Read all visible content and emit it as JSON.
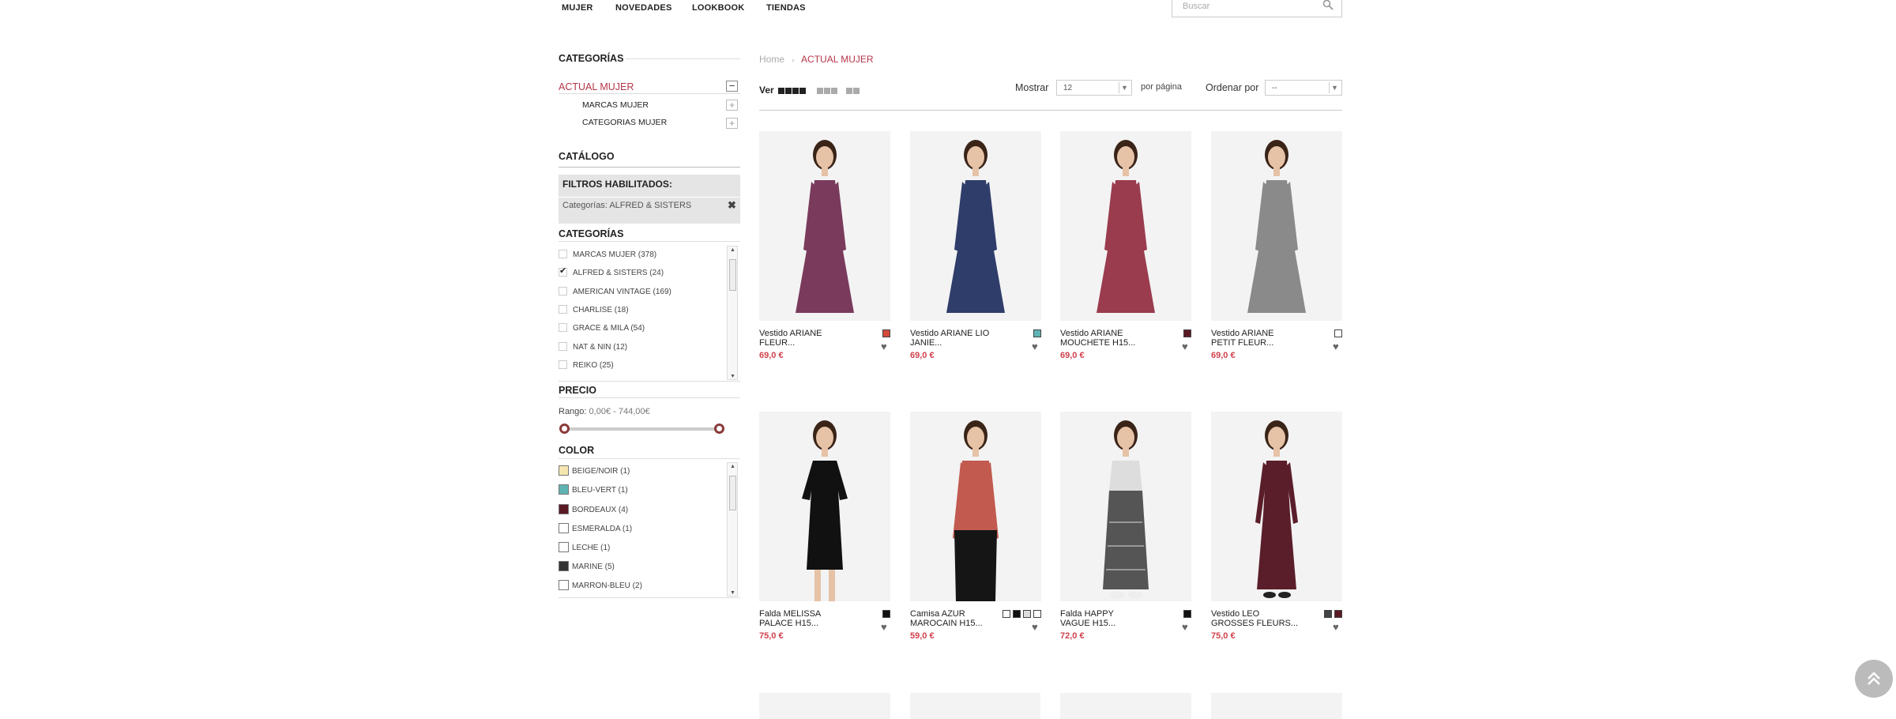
{
  "nav": {
    "items": [
      "MUJER",
      "NOVEDADES",
      "LOOKBOOK",
      "TIENDAS"
    ]
  },
  "search": {
    "placeholder": "Buscar"
  },
  "sidebar": {
    "categories_title": "CATEGORÍAS",
    "current_category": "ACTUAL MUJER",
    "subcategories": [
      "MARCAS MUJER",
      "CATEGORIAS MUJER"
    ],
    "catalog_title": "CATÁLOGO",
    "filters_title": "FILTROS HABILITADOS:",
    "active_filter": "Categorías: ALFRED & SISTERS",
    "cat_filter_title": "CATEGORÍAS",
    "cat_options": [
      {
        "label": "MARCAS MUJER (378)",
        "checked": false
      },
      {
        "label": "ALFRED & SISTERS (24)",
        "checked": true
      },
      {
        "label": "AMERICAN VINTAGE (169)",
        "checked": false
      },
      {
        "label": "CHARLISE (18)",
        "checked": false
      },
      {
        "label": "GRACE & MILA (54)",
        "checked": false
      },
      {
        "label": "NAT & NIN (12)",
        "checked": false
      },
      {
        "label": "REIKO (25)",
        "checked": false
      }
    ],
    "price_title": "PRECIO",
    "range_label": "Rango:",
    "range_value": "0,00€ - 744,00€",
    "range_min_fraction": 0,
    "range_max_fraction": 1,
    "color_title": "COLOR",
    "colors": [
      {
        "label": "BEIGE/NOIR (1)",
        "color": "#f5e6b0"
      },
      {
        "label": "BLEU-VERT (1)",
        "color": "#5fb3b3"
      },
      {
        "label": "BORDEAUX (4)",
        "color": "#5a1a24"
      },
      {
        "label": "ESMERALDA (1)",
        "color": "#ffffff"
      },
      {
        "label": "LECHE (1)",
        "color": "#ffffff"
      },
      {
        "label": "MARINE (5)",
        "color": "#333333"
      },
      {
        "label": "MARRON-BLEU (2)",
        "color": "#ffffff"
      }
    ]
  },
  "breadcrumb": {
    "home": "Home",
    "current": "ACTUAL MUJER"
  },
  "toolbar": {
    "view_label": "Ver",
    "show_label": "Mostrar",
    "show_value": "12",
    "per_page": "por página",
    "sort_label": "Ordenar por",
    "sort_value": "--"
  },
  "products": [
    {
      "name1": "Vestido ARIANE",
      "name2": "FLEUR...",
      "price": "69,0 €",
      "swatches": [
        "#d24a3c"
      ],
      "garment": "#7a3a5c",
      "style": "dress"
    },
    {
      "name1": "Vestido ARIANE LIO",
      "name2": "JANIE...",
      "price": "69,0 €",
      "swatches": [
        "#5fb3b3"
      ],
      "garment": "#2f3d6a",
      "style": "dress"
    },
    {
      "name1": "Vestido ARIANE",
      "name2": "MOUCHETE H15...",
      "price": "69,0 €",
      "swatches": [
        "#5a1a24"
      ],
      "garment": "#9a3b4e",
      "style": "dress"
    },
    {
      "name1": "Vestido ARIANE",
      "name2": "PETIT FLEUR...",
      "price": "69,0 €",
      "swatches": [
        "#ffffff"
      ],
      "garment": "#8a8a8a",
      "style": "dress"
    },
    {
      "name1": "Falda MELISSA",
      "name2": "PALACE H15...",
      "price": "75,0 €",
      "swatches": [
        "#111111"
      ],
      "garment": "#111111",
      "style": "dress2"
    },
    {
      "name1": "Camisa AZUR",
      "name2": "MAROCAIN H15...",
      "price": "59,0 €",
      "swatches": [
        "#ffffff",
        "#111111",
        "#dddddd",
        "#ffffff"
      ],
      "garment": "#c25a50",
      "style": "shirt"
    },
    {
      "name1": "Falda HAPPY",
      "name2": "VAGUE H15...",
      "price": "72,0 €",
      "swatches": [
        "#111111"
      ],
      "garment": "#555555",
      "style": "skirt"
    },
    {
      "name1": "Vestido LEO",
      "name2": "GROSSES FLEURS...",
      "price": "75,0 €",
      "swatches": [
        "#444444",
        "#5a1a24"
      ],
      "garment": "#5a1e2a",
      "style": "long"
    }
  ],
  "icons": {
    "search": "search-icon",
    "heart": "heart-icon",
    "back_to_top": "double-chevron-up-icon",
    "close": "close-icon"
  }
}
